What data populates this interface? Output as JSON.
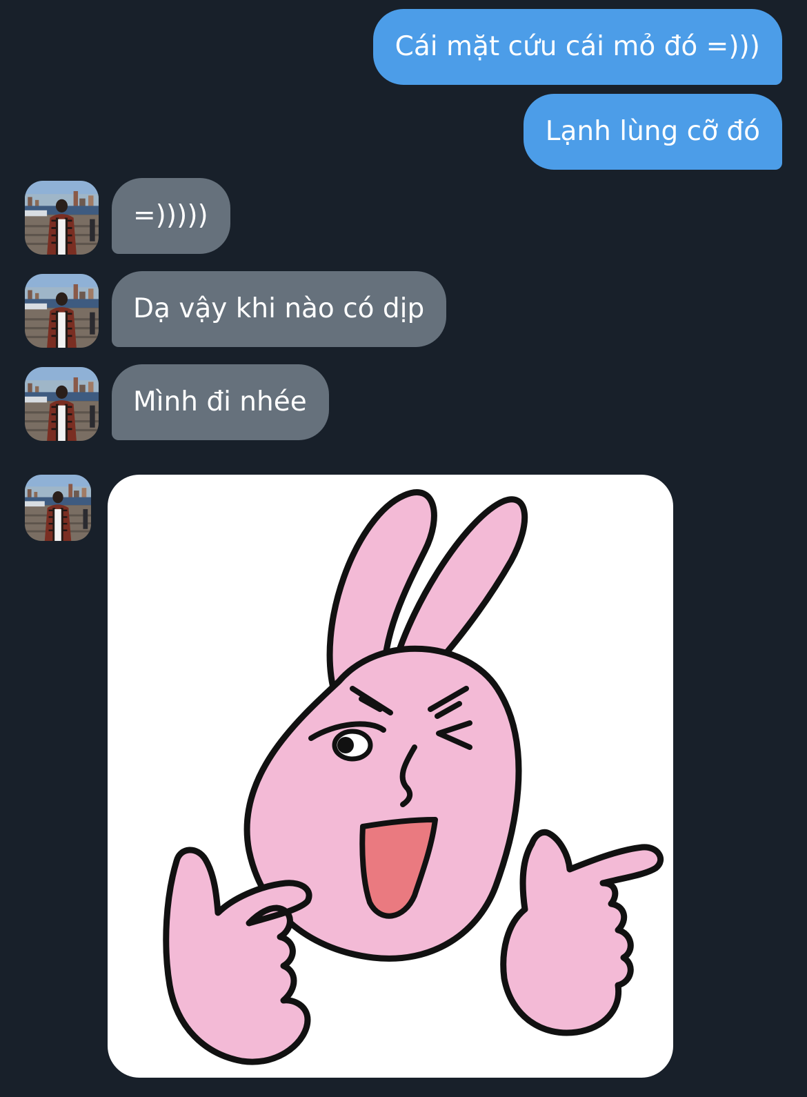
{
  "chat": {
    "messages": [
      {
        "direction": "outgoing",
        "text": "Cái mặt cứu cái mỏ đó =)))"
      },
      {
        "direction": "outgoing",
        "text": "Lạnh lùng cỡ đó"
      },
      {
        "direction": "incoming",
        "text": "=)))))"
      },
      {
        "direction": "incoming",
        "text": "Dạ vậy khi nào có dịp"
      },
      {
        "direction": "incoming",
        "text": "Mình đi nhée"
      },
      {
        "direction": "incoming",
        "type": "sticker",
        "sticker_icon": "pink-bunny-wink-pointing-sticker"
      }
    ]
  },
  "avatar_icon": "user-avatar-photo",
  "colors": {
    "background": "#18202a",
    "outgoing_bubble": "#4c9de8",
    "incoming_bubble": "#66717c",
    "text": "#ffffff",
    "sticker_pink": "#f3bad6",
    "sticker_tongue": "#ea7a80"
  }
}
